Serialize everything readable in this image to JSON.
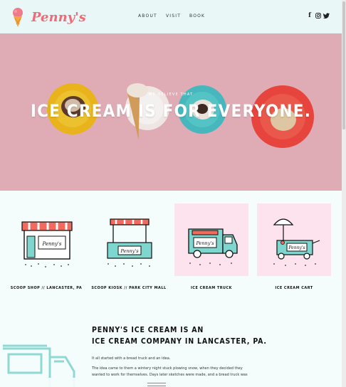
{
  "brand": {
    "logo_text": "Penny's"
  },
  "nav": {
    "about": "ABOUT",
    "visit": "VISIT",
    "book": "BOOK"
  },
  "social": {
    "facebook": "f",
    "instagram": "◎",
    "twitter": "🐦"
  },
  "hero": {
    "pretitle": "WE BELIEVE THAT",
    "title": "ICE CREAM IS FOR EVERYONE."
  },
  "locations": [
    {
      "label": "SCOOP SHOP // LANCASTER, PA",
      "sign": "Penny's"
    },
    {
      "label": "SCOOP KIOSK // PARK CITY MALL",
      "sign": "Penny's"
    },
    {
      "label": "ICE CREAM TRUCK",
      "sign": "Penny's"
    },
    {
      "label": "ICE CREAM CART",
      "sign": "Penny's"
    }
  ],
  "about": {
    "heading_line1": "PENNY'S ICE CREAM IS AN",
    "heading_line2": "ICE CREAM COMPANY IN LANCASTER, PA.",
    "p1": "It all started with a bread truck and an idea.",
    "p2": "The idea came to them a wintery night stuck plowing snow, when they decided they wanted to work for themselves. Days later sketches were made, and a bread truck was purchased in"
  },
  "colors": {
    "accent": "#f06a78",
    "mint": "#e9f8f6",
    "hero_pink": "#e9b6bf",
    "card_pink": "#fce3ee",
    "teal": "#7fd6cf"
  }
}
